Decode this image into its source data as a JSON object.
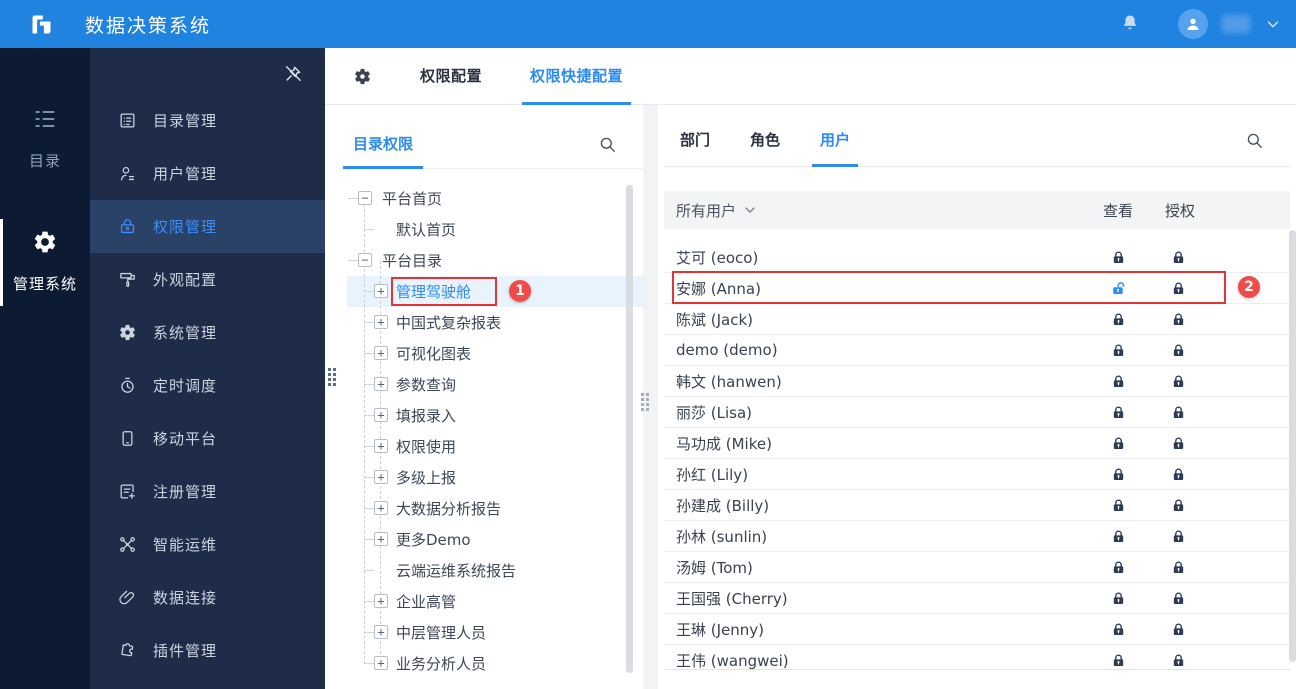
{
  "header": {
    "title": "数据决策系统",
    "logo_icon": "finereport-logo-icon",
    "bell_icon": "bell-icon",
    "avatar_icon": "user-avatar-icon",
    "chevron_icon": "chevron-down-icon"
  },
  "left_rail": {
    "items": [
      {
        "key": "catalog",
        "label": "目录",
        "icon": "list-icon",
        "active": false
      },
      {
        "key": "manage-system",
        "label": "管理系统",
        "icon": "gear-icon",
        "active": true
      }
    ]
  },
  "sidebar": {
    "unpin_icon": "unpin-icon",
    "items": [
      {
        "key": "catalog-management",
        "label": "目录管理",
        "icon": "document-list-icon",
        "active": false
      },
      {
        "key": "user-management",
        "label": "用户管理",
        "icon": "user-icon",
        "active": false
      },
      {
        "key": "permission-management",
        "label": "权限管理",
        "icon": "lock-icon",
        "active": true
      },
      {
        "key": "appearance-config",
        "label": "外观配置",
        "icon": "paint-roller-icon",
        "active": false
      },
      {
        "key": "system-management",
        "label": "系统管理",
        "icon": "gear-outline-icon",
        "active": false
      },
      {
        "key": "scheduled-tasks",
        "label": "定时调度",
        "icon": "timer-icon",
        "active": false
      },
      {
        "key": "mobile-platform",
        "label": "移动平台",
        "icon": "mobile-icon",
        "active": false
      },
      {
        "key": "registration",
        "label": "注册管理",
        "icon": "register-icon",
        "active": false
      },
      {
        "key": "intelligent-ops",
        "label": "智能运维",
        "icon": "nodes-icon",
        "active": false
      },
      {
        "key": "data-connection",
        "label": "数据连接",
        "icon": "paperclip-icon",
        "active": false
      },
      {
        "key": "plugin-management",
        "label": "插件管理",
        "icon": "puzzle-icon",
        "active": false
      }
    ]
  },
  "tabs": {
    "gear_icon": "gear-outline-icon",
    "items": [
      {
        "label": "权限配置",
        "active": false
      },
      {
        "label": "权限快捷配置",
        "active": true
      }
    ]
  },
  "tree_panel": {
    "tab_label": "目录权限",
    "search_icon": "search-icon",
    "nodes": [
      {
        "label": "平台首页",
        "level": 0,
        "expander": "minus",
        "selected": false
      },
      {
        "label": "默认首页",
        "level": 1,
        "expander": "none",
        "selected": false
      },
      {
        "label": "平台目录",
        "level": 0,
        "expander": "minus",
        "selected": false
      },
      {
        "label": "管理驾驶舱",
        "level": 1,
        "expander": "plus",
        "selected": true,
        "badge": "1"
      },
      {
        "label": "中国式复杂报表",
        "level": 1,
        "expander": "plus",
        "selected": false
      },
      {
        "label": "可视化图表",
        "level": 1,
        "expander": "plus",
        "selected": false
      },
      {
        "label": "参数查询",
        "level": 1,
        "expander": "plus",
        "selected": false
      },
      {
        "label": "填报录入",
        "level": 1,
        "expander": "plus",
        "selected": false
      },
      {
        "label": "权限使用",
        "level": 1,
        "expander": "plus",
        "selected": false
      },
      {
        "label": "多级上报",
        "level": 1,
        "expander": "plus",
        "selected": false
      },
      {
        "label": "大数据分析报告",
        "level": 1,
        "expander": "plus",
        "selected": false
      },
      {
        "label": "更多Demo",
        "level": 1,
        "expander": "plus",
        "selected": false
      },
      {
        "label": "云端运维系统报告",
        "level": 1,
        "expander": "none",
        "selected": false
      },
      {
        "label": "企业高管",
        "level": 1,
        "expander": "plus",
        "selected": false
      },
      {
        "label": "中层管理人员",
        "level": 1,
        "expander": "plus",
        "selected": false
      },
      {
        "label": "业务分析人员",
        "level": 1,
        "expander": "plus",
        "selected": false
      }
    ]
  },
  "users_panel": {
    "tabs": [
      {
        "label": "部门",
        "active": false
      },
      {
        "label": "角色",
        "active": false
      },
      {
        "label": "用户",
        "active": true
      }
    ],
    "search_icon": "search-icon",
    "filter_label": "所有用户",
    "filter_chevron_icon": "chevron-down-icon",
    "columns": {
      "view": "查看",
      "auth": "授权"
    },
    "users": [
      {
        "name": "艾可 (eoco)",
        "view": "locked",
        "auth": "locked"
      },
      {
        "name": "安娜 (Anna)",
        "view": "unlocked",
        "auth": "locked",
        "badge": "2"
      },
      {
        "name": "陈斌 (Jack)",
        "view": "locked",
        "auth": "locked"
      },
      {
        "name": "demo (demo)",
        "view": "locked",
        "auth": "locked"
      },
      {
        "name": "韩文 (hanwen)",
        "view": "locked",
        "auth": "locked"
      },
      {
        "name": "丽莎 (Lisa)",
        "view": "locked",
        "auth": "locked"
      },
      {
        "name": "马功成 (Mike)",
        "view": "locked",
        "auth": "locked"
      },
      {
        "name": "孙红 (Lily)",
        "view": "locked",
        "auth": "locked"
      },
      {
        "name": "孙建成 (Billy)",
        "view": "locked",
        "auth": "locked"
      },
      {
        "name": "孙林 (sunlin)",
        "view": "locked",
        "auth": "locked"
      },
      {
        "name": "汤姆 (Tom)",
        "view": "locked",
        "auth": "locked"
      },
      {
        "name": "王国强 (Cherry)",
        "view": "locked",
        "auth": "locked"
      },
      {
        "name": "王琳 (Jenny)",
        "view": "locked",
        "auth": "locked"
      },
      {
        "name": "王伟 (wangwei)",
        "view": "locked",
        "auth": "locked"
      }
    ]
  },
  "annotations": [
    {
      "number": "1",
      "target": "管理驾驶舱"
    },
    {
      "number": "2",
      "target": "安娜 (Anna)"
    }
  ],
  "colors": {
    "topbar_blue": "#2183e0",
    "rail_navy": "#0c1a32",
    "sidebar_navy": "#1e2c49",
    "sidebar_active_bg": "#2a4168",
    "accent_blue": "#2d8cf0",
    "selected_row_bg": "#e8f3fd",
    "annotation_red": "#e23434",
    "badge_red": "#f04b4b",
    "lock_navy": "#2e3b57",
    "header_row_grey": "#f2f4f6"
  }
}
